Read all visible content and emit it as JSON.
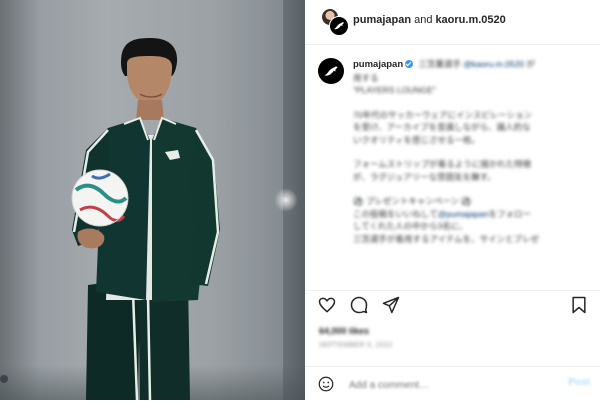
{
  "header": {
    "owner": "pumajapan",
    "conjunction": "and",
    "collaborator": "kaoru.m.0520"
  },
  "caption": {
    "username": "pumajapan",
    "mention_prefix": "三笘薫選手",
    "mention_handle": "@kaoru.m.0520",
    "mention_suffix": "が",
    "line_2": "用する",
    "line_3": "\"PLAYERS LOUNGE\"",
    "para_2": [
      "70年代のサッカーウェアにインスピレーション",
      "を受け、アーカイブを意識しながら、踊人的な",
      "いクオリティを感じさせる一枚。"
    ],
    "para_3": [
      "フォームストリップが着るように描かれた特徴",
      "が、ラグジュアリーな雰囲気を醸す。"
    ],
    "campaign_title": "⚽ プレゼントキャンペーン ⚽",
    "campaign_prefix": "この投稿をいいねして",
    "campaign_handle": "@pumajapan",
    "campaign_suffix": "をフォロー",
    "campaign_lines": [
      "してくれた人の中から3名に、",
      "三笘選手が着用するアイテムを、サインとプレゼ"
    ]
  },
  "icons": {
    "like": "heart-icon",
    "comment": "comment-icon",
    "share": "share-icon",
    "bookmark": "bookmark-icon",
    "emoji": "emoji-icon",
    "brand": "puma-logo-icon"
  },
  "likes_text": "64,000 likes",
  "date_text": "SEPTEMBER 5, 2022",
  "comment": {
    "placeholder": "Add a comment…",
    "post_label": "Post"
  },
  "colors": {
    "link": "#00376b",
    "verified": "#3897f0",
    "post_button": "#b2dffc"
  }
}
